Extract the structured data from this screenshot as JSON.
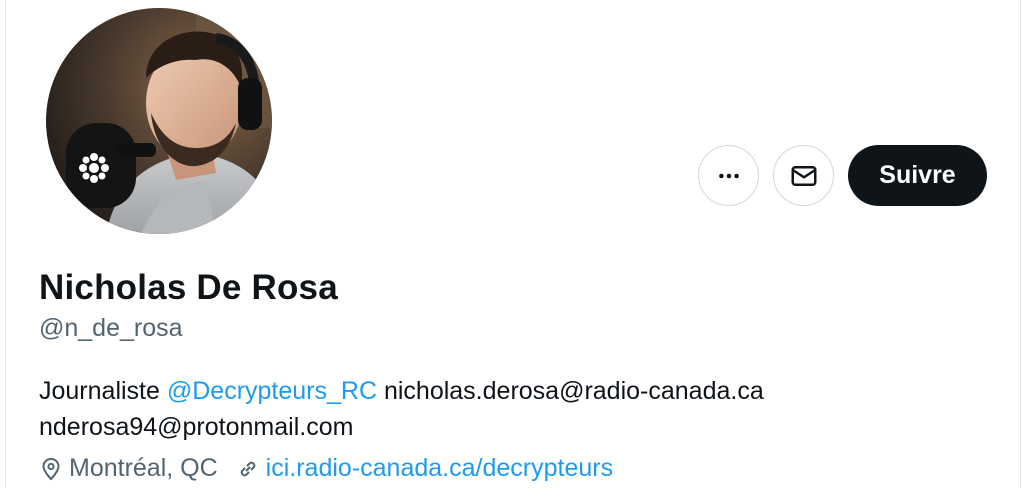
{
  "profile": {
    "name": "Nicholas De Rosa",
    "handle": "@n_de_rosa",
    "bio": {
      "prefix": "Journaliste ",
      "mention": "@Decrypteurs_RC",
      "email1": " nicholas.derosa@radio-canada.ca",
      "email2": "nderosa94@protonmail.com"
    },
    "location": "Montréal, QC",
    "website": "ici.radio-canada.ca/decrypteurs"
  },
  "actions": {
    "follow_label": "Suivre",
    "more_icon": "more-dots-icon",
    "message_icon": "envelope-icon"
  },
  "colors": {
    "accent": "#1d9bf0",
    "text": "#0f1419",
    "muted": "#536471",
    "button_dark": "#0f1419",
    "border": "#cfd9de"
  }
}
